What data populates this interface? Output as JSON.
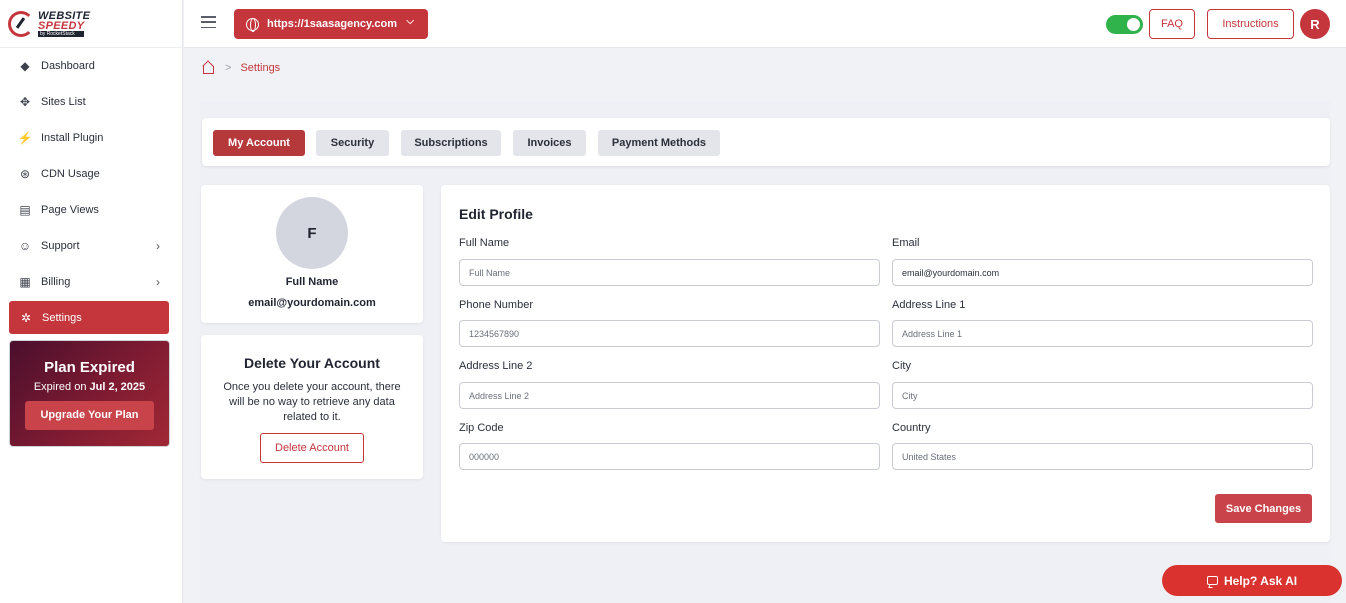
{
  "logo": {
    "line1": "WEBSITE",
    "line2": "SPEEDY",
    "line3": "by RocketStack"
  },
  "sidebar": {
    "items": [
      {
        "label": "Dashboard",
        "icon": "cube-icon",
        "glyph": "◆"
      },
      {
        "label": "Sites List",
        "icon": "sites-icon",
        "glyph": "✥"
      },
      {
        "label": "Install Plugin",
        "icon": "plug-icon",
        "glyph": "⚡"
      },
      {
        "label": "CDN Usage",
        "icon": "cdn-icon",
        "glyph": "⊛"
      },
      {
        "label": "Page Views",
        "icon": "page-icon",
        "glyph": "▤"
      },
      {
        "label": "Support",
        "icon": "support-icon",
        "glyph": "☺",
        "chevron": "›"
      },
      {
        "label": "Billing",
        "icon": "billing-icon",
        "glyph": "▦",
        "chevron": "›"
      },
      {
        "label": "Settings",
        "icon": "gear-icon",
        "glyph": "✲",
        "active": true
      }
    ]
  },
  "plan": {
    "title": "Plan Expired",
    "expired_prefix": "Expired on ",
    "expired_date": "Jul 2, 2025",
    "button": "Upgrade Your Plan"
  },
  "header": {
    "site_url": "https://1saasagency.com",
    "faq": "FAQ",
    "instructions": "Instructions",
    "avatar_initial": "R",
    "toggle_on": true
  },
  "breadcrumb": {
    "separator": ">",
    "current": "Settings"
  },
  "tabs": [
    {
      "label": "My Account",
      "active": true
    },
    {
      "label": "Security"
    },
    {
      "label": "Subscriptions"
    },
    {
      "label": "Invoices"
    },
    {
      "label": "Payment Methods"
    }
  ],
  "profile": {
    "initial": "F",
    "name": "Full Name",
    "email": "email@yourdomain.com"
  },
  "delete_account": {
    "title": "Delete Your Account",
    "text": "Once you delete your account, there will be no way to retrieve any data related to it.",
    "button": "Delete Account"
  },
  "edit_profile": {
    "title": "Edit Profile",
    "fields": {
      "full_name": {
        "label": "Full Name",
        "placeholder": "Full Name",
        "value": ""
      },
      "email": {
        "label": "Email",
        "placeholder": "",
        "value": "email@yourdomain.com"
      },
      "phone": {
        "label": "Phone Number",
        "placeholder": "1234567890",
        "value": ""
      },
      "address1": {
        "label": "Address Line 1",
        "placeholder": "Address Line 1",
        "value": ""
      },
      "address2": {
        "label": "Address Line 2",
        "placeholder": "Address Line 2",
        "value": ""
      },
      "city": {
        "label": "City",
        "placeholder": "City",
        "value": ""
      },
      "zip": {
        "label": "Zip Code",
        "placeholder": "000000",
        "value": ""
      },
      "country": {
        "label": "Country",
        "placeholder": "",
        "value": "United States"
      }
    },
    "save_button": "Save Changes"
  },
  "help": {
    "label": "Help? Ask AI"
  },
  "colors": {
    "accent": "#c4363c",
    "toggle": "#2fb34a",
    "help": "#d9322f"
  }
}
